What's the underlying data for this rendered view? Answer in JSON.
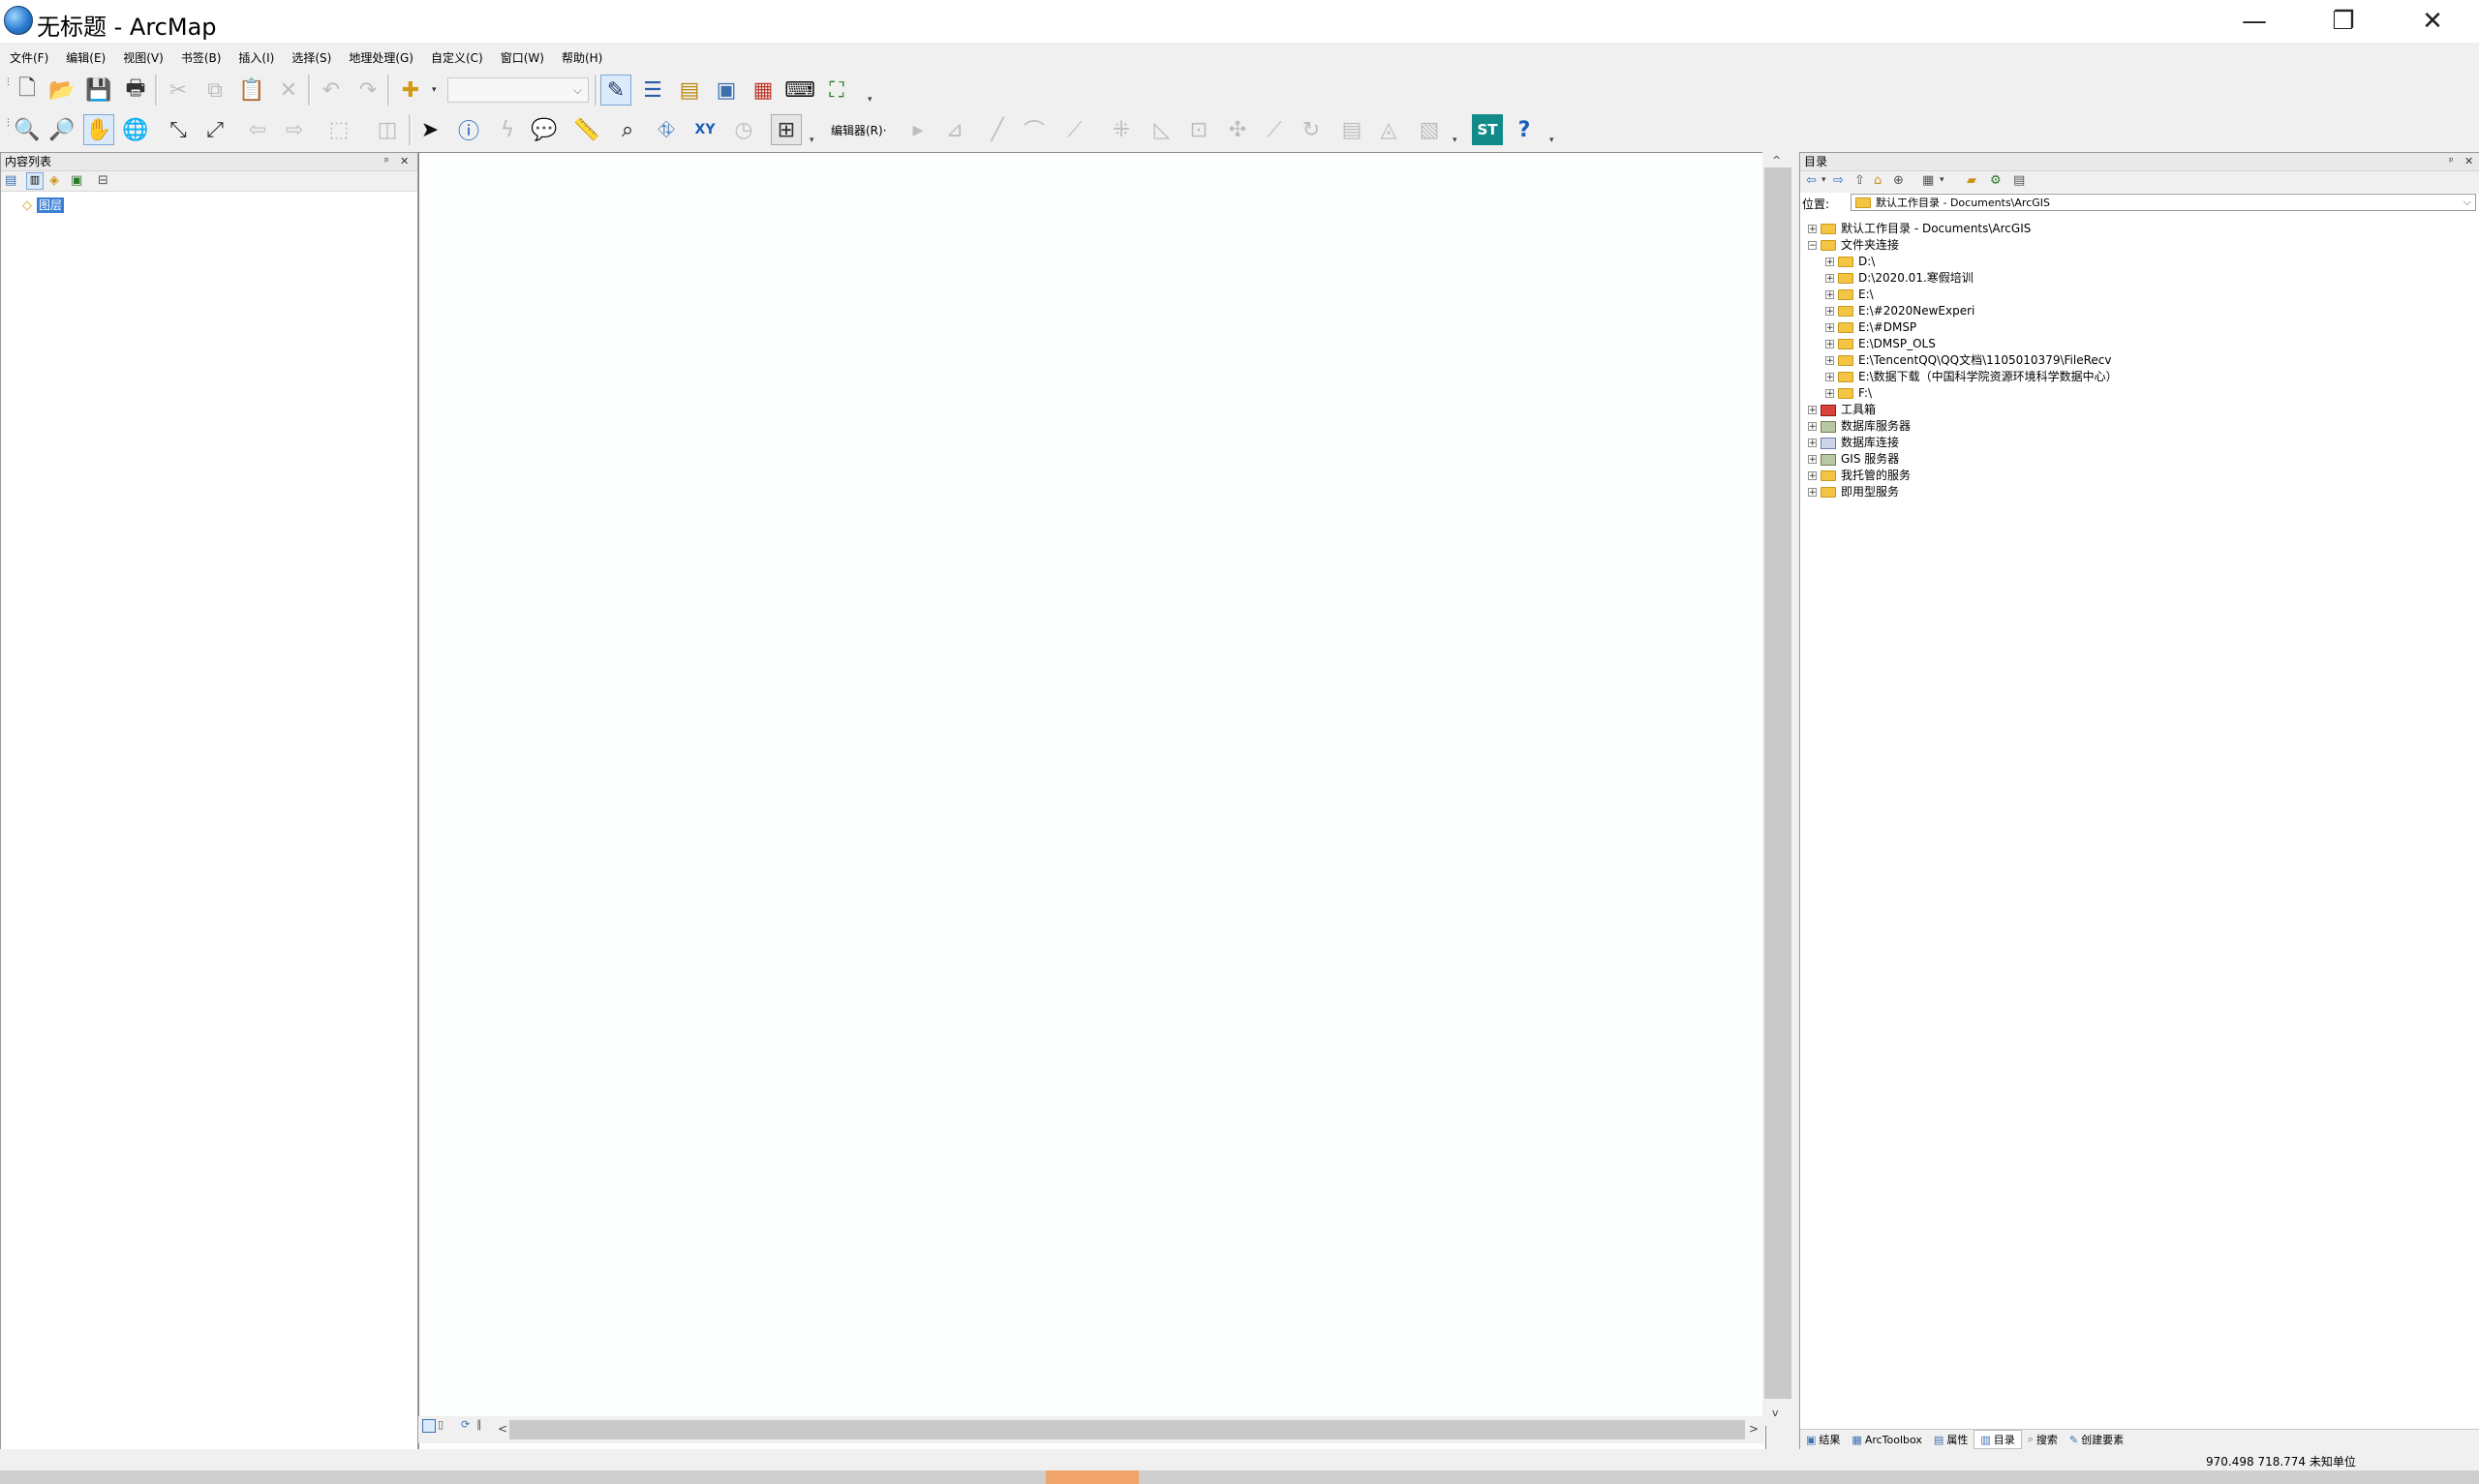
{
  "window": {
    "title": "无标题 - ArcMap",
    "minimize": "—",
    "restore": "❐",
    "close": "✕"
  },
  "menu": [
    "文件(F)",
    "编辑(E)",
    "视图(V)",
    "书签(B)",
    "插入(I)",
    "选择(S)",
    "地理处理(G)",
    "自定义(C)",
    "窗口(W)",
    "帮助(H)"
  ],
  "toolbar": {
    "scale_value": "",
    "editor_label": "编辑器(R)·",
    "st_label": "ST",
    "xy_label": "XY",
    "help_label": "?"
  },
  "toc": {
    "title": "内容列表",
    "pin": "ᵖ",
    "close": "✕",
    "layer": "图层"
  },
  "catalog": {
    "title": "目录",
    "pin": "ᵖ",
    "close": "✕",
    "location_label": "位置:",
    "location_value": "默认工作目录 - Documents\\ArcGIS",
    "items": [
      {
        "label": "默认工作目录 - Documents\\ArcGIS",
        "level": 0,
        "expander": "+",
        "icon": "folder-icon"
      },
      {
        "label": "文件夹连接",
        "level": 0,
        "expander": "−",
        "icon": "folder-icon"
      },
      {
        "label": "D:\\",
        "level": 1,
        "expander": "+",
        "icon": "folder-icon"
      },
      {
        "label": "D:\\2020.01.寒假培训",
        "level": 1,
        "expander": "+",
        "icon": "folder-icon"
      },
      {
        "label": "E:\\",
        "level": 1,
        "expander": "+",
        "icon": "folder-icon"
      },
      {
        "label": "E:\\#2020NewExperi",
        "level": 1,
        "expander": "+",
        "icon": "folder-icon"
      },
      {
        "label": "E:\\#DMSP",
        "level": 1,
        "expander": "+",
        "icon": "folder-icon"
      },
      {
        "label": "E:\\DMSP_OLS",
        "level": 1,
        "expander": "+",
        "icon": "folder-icon"
      },
      {
        "label": "E:\\TencentQQ\\QQ文档\\1105010379\\FileRecv",
        "level": 1,
        "expander": "+",
        "icon": "folder-icon"
      },
      {
        "label": "E:\\数据下载（中国科学院资源环境科学数据中心）",
        "level": 1,
        "expander": "+",
        "icon": "folder-icon"
      },
      {
        "label": "F:\\",
        "level": 1,
        "expander": "+",
        "icon": "folder-icon"
      },
      {
        "label": "工具箱",
        "level": 0,
        "expander": "+",
        "icon": "toolbox-icon"
      },
      {
        "label": "数据库服务器",
        "level": 0,
        "expander": "+",
        "icon": "server-icon"
      },
      {
        "label": "数据库连接",
        "level": 0,
        "expander": "+",
        "icon": "database-connection-icon"
      },
      {
        "label": "GIS 服务器",
        "level": 0,
        "expander": "+",
        "icon": "server-icon"
      },
      {
        "label": "我托管的服务",
        "level": 0,
        "expander": "+",
        "icon": "folder-icon"
      },
      {
        "label": "即用型服务",
        "level": 0,
        "expander": "+",
        "icon": "folder-icon"
      }
    ],
    "tabs": [
      "结果",
      "ArcToolbox",
      "属性",
      "目录",
      "搜索",
      "创建要素"
    ]
  },
  "map": {
    "scroll_up": "^",
    "scroll_down": "v",
    "scroll_left": "<",
    "scroll_right": ">"
  },
  "status": {
    "coords": "970.498  718.774 未知单位"
  }
}
